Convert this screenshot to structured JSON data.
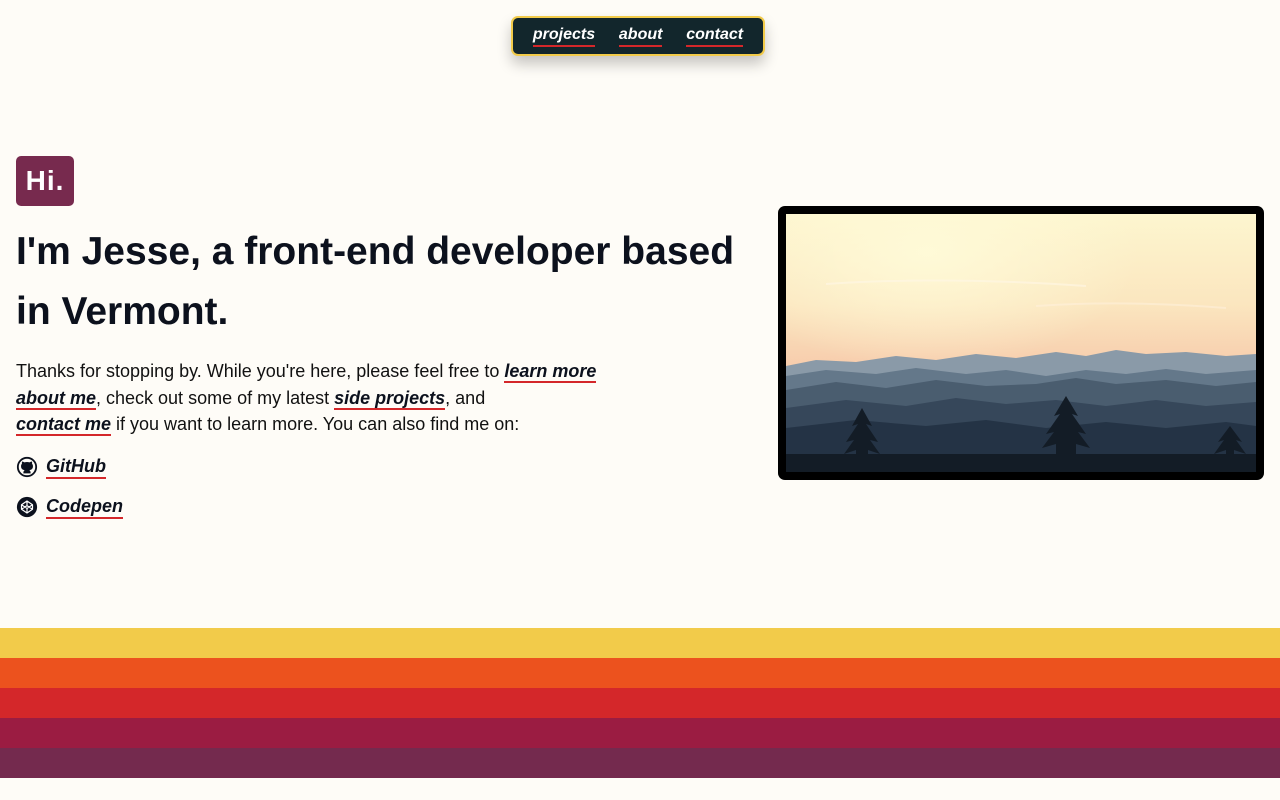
{
  "nav": {
    "items": [
      {
        "label": "projects"
      },
      {
        "label": "about"
      },
      {
        "label": "contact"
      }
    ]
  },
  "hero": {
    "badge": "Hi.",
    "headline": "I'm Jesse, a front-end developer based in Vermont.",
    "intro": {
      "text1": "Thanks for stopping by. While you're here, please feel free to ",
      "link_about": "learn more about me",
      "text2": ", check out some of my latest ",
      "link_projects": "side projects",
      "text3": ", and ",
      "link_contact": "contact me",
      "text4": " if you want to learn more. You can also find me on:"
    },
    "social": [
      {
        "label": "GitHub",
        "icon": "github-icon"
      },
      {
        "label": "Codepen",
        "icon": "codepen-icon"
      }
    ],
    "photo": {
      "icon": "mountain-landscape-photo"
    }
  },
  "stripes": {
    "colors": [
      "#f2cb4a",
      "#ec521e",
      "#d4272a",
      "#9b1c42",
      "#742a4e"
    ]
  },
  "colors": {
    "background": "#fefcf7",
    "nav_background": "#12262c",
    "nav_border": "#f2cb4a",
    "link_underline": "#d4272a",
    "badge": "#772a4e"
  }
}
